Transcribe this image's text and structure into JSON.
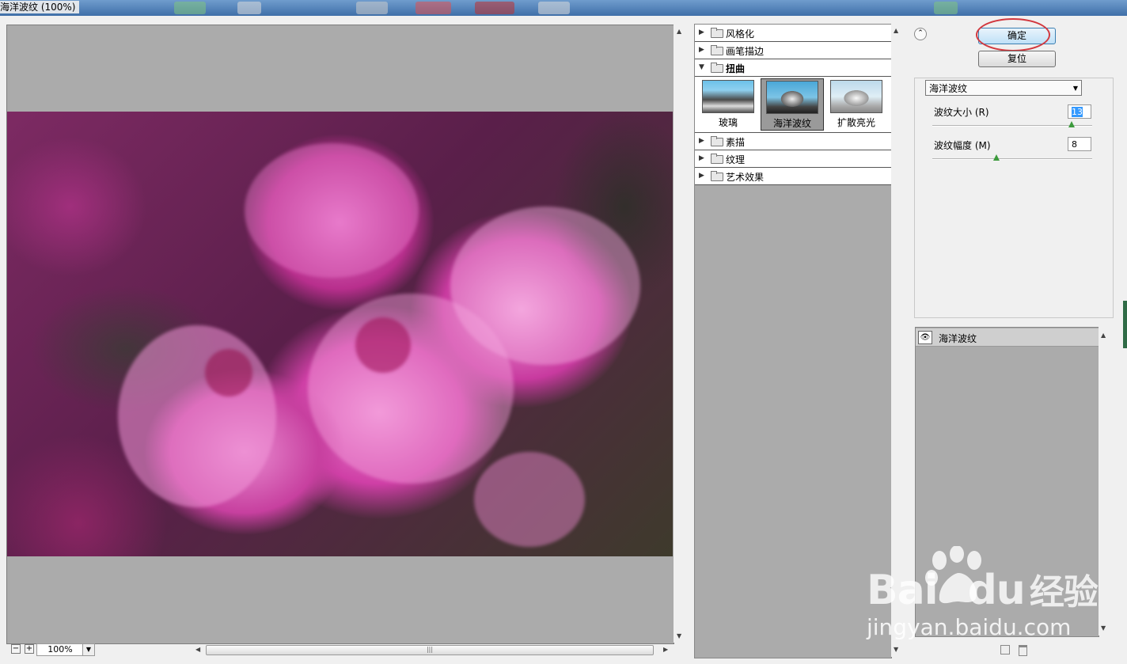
{
  "window": {
    "title": "海洋波纹 (100%)"
  },
  "preview": {
    "zoom": "100%",
    "zoom_out": "−",
    "zoom_in": "+"
  },
  "gallery": {
    "categories": [
      {
        "name": "风格化",
        "expanded": false
      },
      {
        "name": "画笔描边",
        "expanded": false
      },
      {
        "name": "扭曲",
        "expanded": true
      },
      {
        "name": "素描",
        "expanded": false
      },
      {
        "name": "纹理",
        "expanded": false
      },
      {
        "name": "艺术效果",
        "expanded": false
      }
    ],
    "distort_filters": [
      {
        "label": "玻璃",
        "selected": false
      },
      {
        "label": "海洋波纹",
        "selected": true
      },
      {
        "label": "扩散亮光",
        "selected": false
      }
    ]
  },
  "buttons": {
    "ok": "确定",
    "reset": "复位"
  },
  "settings": {
    "filter_select": "海洋波纹",
    "params": [
      {
        "label": "波纹大小 (R)",
        "value": "13",
        "slider_fraction": 0.87
      },
      {
        "label": "波纹幅度 (M)",
        "value": "8",
        "slider_fraction": 0.4
      }
    ]
  },
  "layers": [
    {
      "name": "海洋波纹",
      "visible": true
    }
  ],
  "watermark": {
    "logo_a": "Bai",
    "logo_b": "du",
    "logo_c": "经验",
    "url": "jingyan.baidu.com"
  },
  "colors": {
    "highlight_circle": "#d2383e",
    "preview_bg": "#ababab",
    "slider_knob": "#3c9a3c"
  }
}
